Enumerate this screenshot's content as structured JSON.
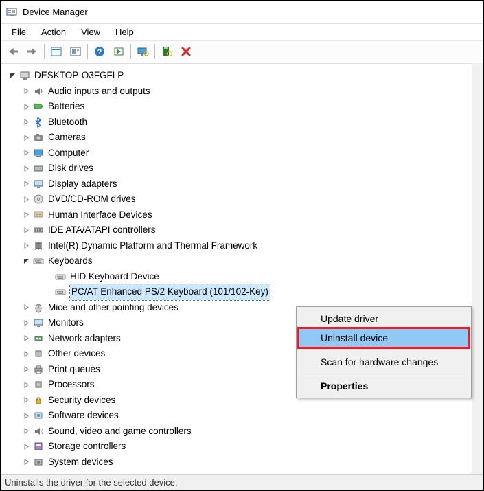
{
  "window": {
    "title": "Device Manager"
  },
  "menubar": {
    "items": [
      "File",
      "Action",
      "View",
      "Help"
    ]
  },
  "toolbar": {
    "back": "Back",
    "forward": "Forward",
    "show_hide": "Show/Hide Console Tree",
    "properties": "Properties",
    "help": "Help",
    "action": "Action",
    "monitor": "Show hidden devices",
    "scan": "Scan for hardware changes",
    "uninstall": "Uninstall device"
  },
  "tree": {
    "root": {
      "label": "DESKTOP-O3FGFLP",
      "expanded": true,
      "children": [
        {
          "label": "Audio inputs and outputs",
          "icon": "speaker",
          "expanded": false
        },
        {
          "label": "Batteries",
          "icon": "battery",
          "expanded": false
        },
        {
          "label": "Bluetooth",
          "icon": "bluetooth",
          "expanded": false
        },
        {
          "label": "Cameras",
          "icon": "camera",
          "expanded": false
        },
        {
          "label": "Computer",
          "icon": "computer",
          "expanded": false
        },
        {
          "label": "Disk drives",
          "icon": "disk",
          "expanded": false
        },
        {
          "label": "Display adapters",
          "icon": "display",
          "expanded": false
        },
        {
          "label": "DVD/CD-ROM drives",
          "icon": "dvd",
          "expanded": false
        },
        {
          "label": "Human Interface Devices",
          "icon": "hid",
          "expanded": false
        },
        {
          "label": "IDE ATA/ATAPI controllers",
          "icon": "ide",
          "expanded": false
        },
        {
          "label": "Intel(R) Dynamic Platform and Thermal Framework",
          "icon": "chip",
          "expanded": false
        },
        {
          "label": "Keyboards",
          "icon": "keyboard",
          "expanded": true,
          "children": [
            {
              "label": "HID Keyboard Device",
              "icon": "keyboard",
              "leaf": true
            },
            {
              "label": "PC/AT Enhanced PS/2 Keyboard (101/102-Key)",
              "icon": "keyboard",
              "leaf": true,
              "selected": true
            }
          ]
        },
        {
          "label": "Mice and other pointing devices",
          "icon": "mouse",
          "expanded": false
        },
        {
          "label": "Monitors",
          "icon": "monitor",
          "expanded": false
        },
        {
          "label": "Network adapters",
          "icon": "network",
          "expanded": false
        },
        {
          "label": "Other devices",
          "icon": "other",
          "expanded": false
        },
        {
          "label": "Print queues",
          "icon": "printer",
          "expanded": false
        },
        {
          "label": "Processors",
          "icon": "cpu",
          "expanded": false
        },
        {
          "label": "Security devices",
          "icon": "security",
          "expanded": false
        },
        {
          "label": "Software devices",
          "icon": "software",
          "expanded": false
        },
        {
          "label": "Sound, video and game controllers",
          "icon": "sound",
          "expanded": false
        },
        {
          "label": "Storage controllers",
          "icon": "storage",
          "expanded": false
        },
        {
          "label": "System devices",
          "icon": "system",
          "expanded": false
        }
      ]
    }
  },
  "context_menu": {
    "items": [
      {
        "label": "Update driver",
        "type": "item"
      },
      {
        "label": "Uninstall device",
        "type": "item",
        "highlighted": true
      },
      {
        "type": "sep"
      },
      {
        "label": "Scan for hardware changes",
        "type": "item"
      },
      {
        "type": "sep"
      },
      {
        "label": "Properties",
        "type": "item",
        "bold": true
      }
    ]
  },
  "statusbar": {
    "text": "Uninstalls the driver for the selected device."
  }
}
